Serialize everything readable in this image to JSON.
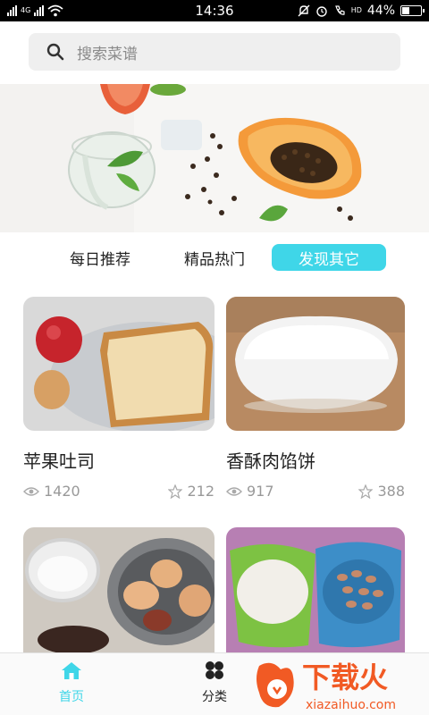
{
  "status_bar": {
    "time": "14:36",
    "network_label": "4G",
    "battery": "44%",
    "battery_level": 0.44,
    "volte": "HD"
  },
  "search": {
    "placeholder": "搜索菜谱"
  },
  "tabs": [
    {
      "label": "每日推荐",
      "active": false
    },
    {
      "label": "精品热门",
      "active": false
    },
    {
      "label": "发现其它",
      "active": true
    }
  ],
  "recipes": [
    {
      "title": "苹果吐司",
      "views": "1420",
      "likes": "212"
    },
    {
      "title": "香酥肉馅饼",
      "views": "917",
      "likes": "388"
    },
    {
      "title": "",
      "views": "",
      "likes": ""
    },
    {
      "title": "",
      "views": "",
      "likes": ""
    }
  ],
  "bottom_nav": {
    "home": "首页",
    "category": "分类"
  },
  "watermark": {
    "brand": "下载火",
    "url": "xiazaihuo.com"
  },
  "colors": {
    "accent": "#3fd6e8",
    "watermark": "#f15a24"
  }
}
